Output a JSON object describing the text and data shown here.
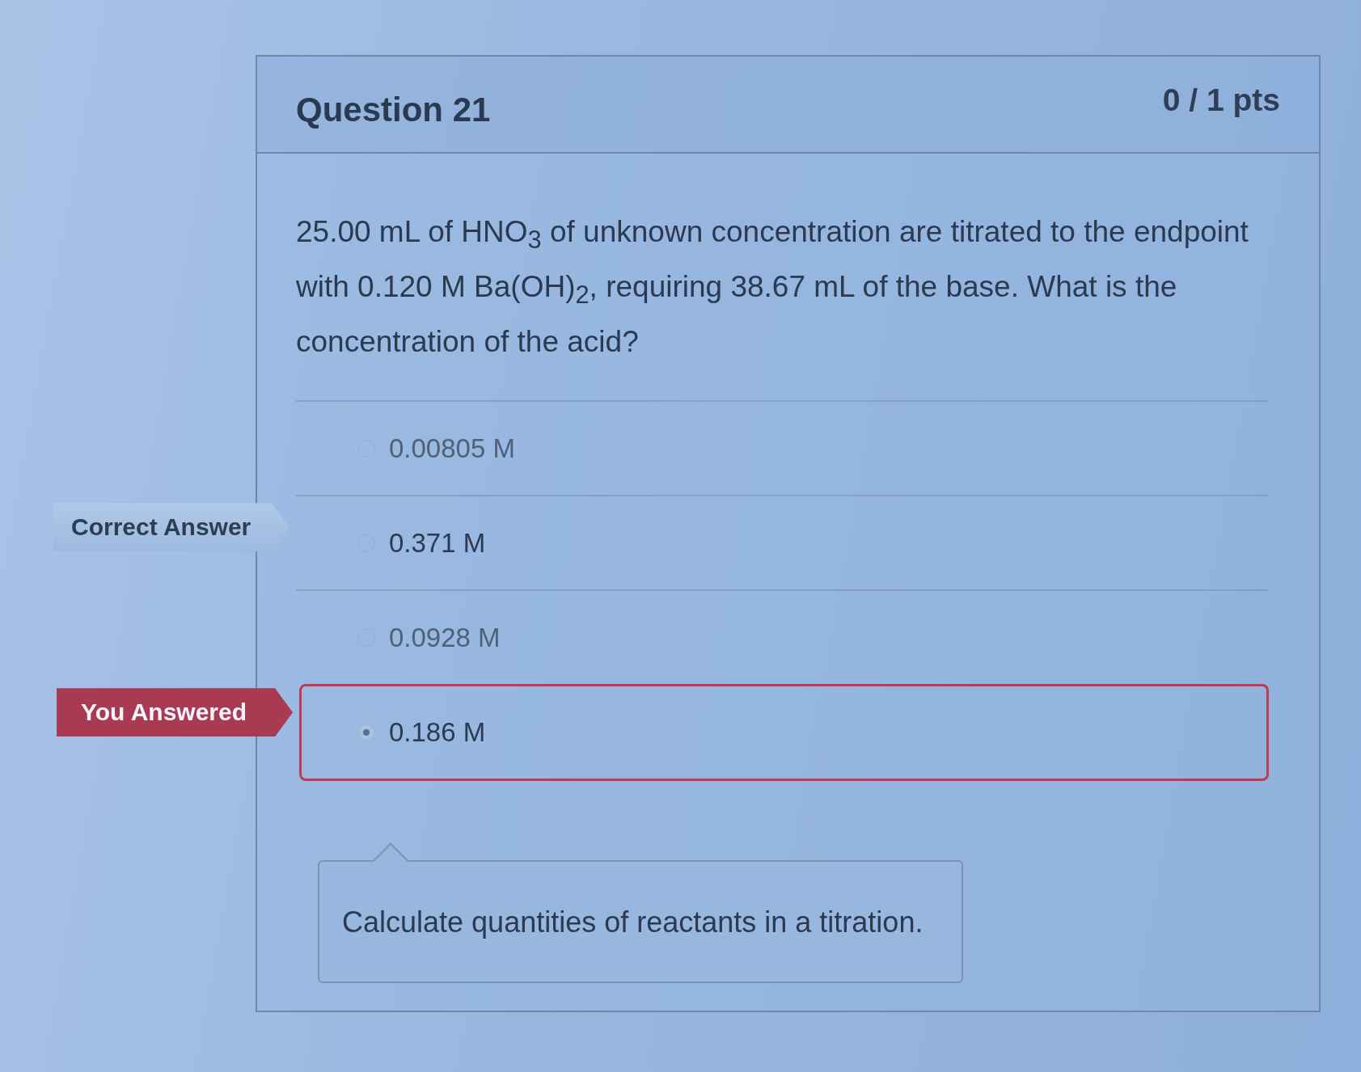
{
  "question": {
    "title": "Question 21",
    "points": "0 / 1 pts",
    "text": "25.00 mL of HNO$_{3}$ of unknown concentration are titrated to the endpoint with 0.120 M Ba(OH)$_{2}$, requiring 38.67 mL of the base. What is the concentration of the acid?"
  },
  "answers": [
    {
      "text": "0.00805 M",
      "selected": false
    },
    {
      "text": "0.371 M",
      "selected": false,
      "tag": {
        "kind": "correct",
        "label": "Correct Answer"
      }
    },
    {
      "text": "0.0928 M",
      "selected": false
    },
    {
      "text": "0.186 M",
      "selected": true,
      "tag": {
        "kind": "wrong",
        "label": "You Answered"
      }
    }
  ],
  "feedback": {
    "text": "Calculate quantities of reactants in a titration."
  }
}
